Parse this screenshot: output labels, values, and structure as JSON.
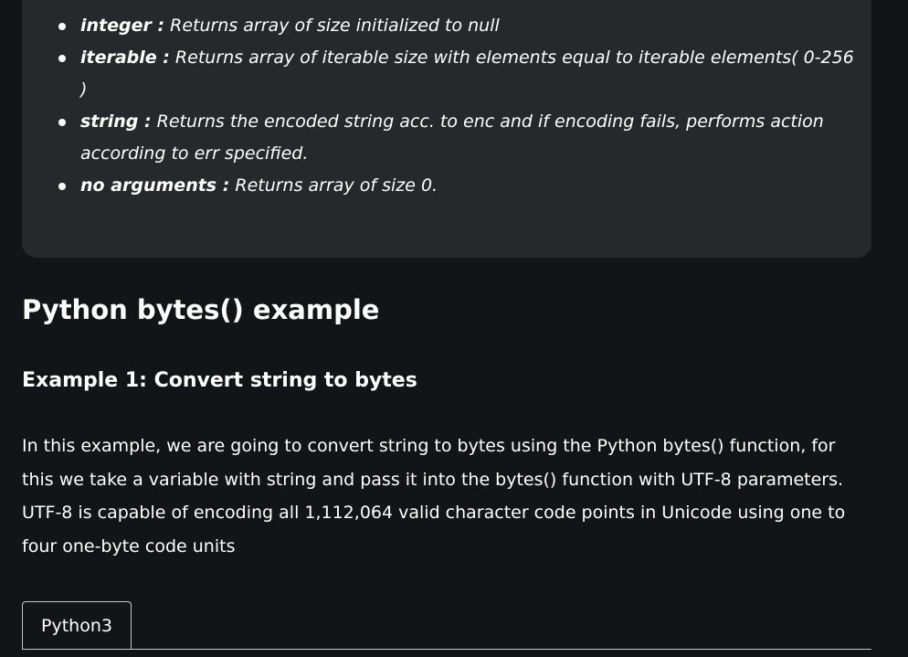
{
  "return_values": {
    "items": [
      {
        "term": "integer :",
        "description": " Returns array of size initialized to null"
      },
      {
        "term": "iterable :",
        "description": " Returns array of iterable size with elements equal to iterable elements( 0-256 )"
      },
      {
        "term": "string :",
        "description": " Returns the encoded string acc. to enc and if encoding fails, performs action according to err specified."
      },
      {
        "term": "no arguments :",
        "description": " Returns array of size 0."
      }
    ]
  },
  "section": {
    "title": "Python bytes() example"
  },
  "example1": {
    "title": "Example 1: Convert string to bytes",
    "paragraph": " In this example, we are going to convert string to bytes using the Python bytes() function, for this we take a variable with string and pass it into the bytes() function with UTF-8 parameters. UTF-8 is capable of encoding all 1,112,064 valid character code points in Unicode using one to four one-byte code units"
  },
  "code": {
    "tab_label": "Python3"
  },
  "colors": {
    "background": "#131417",
    "card": "#27282b",
    "text": "#ffffff",
    "tab_border": "#c7c8ca"
  }
}
